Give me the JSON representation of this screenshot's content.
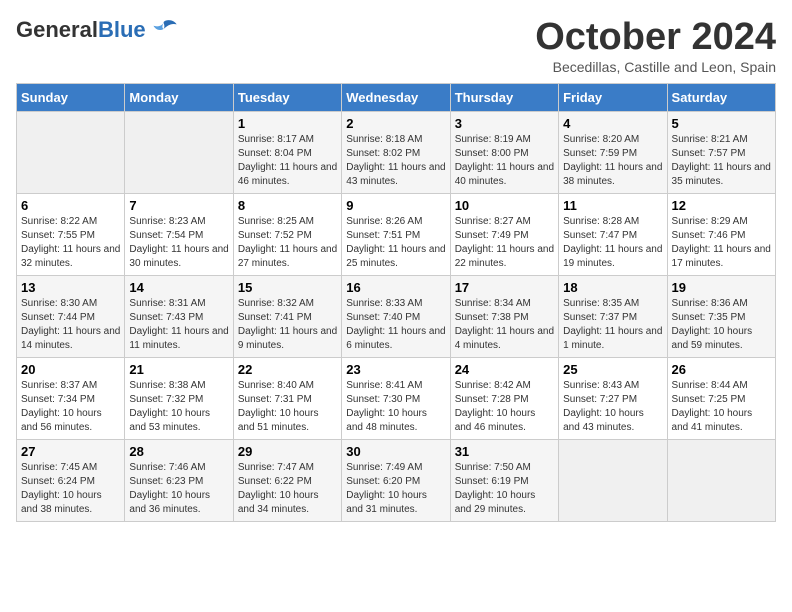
{
  "header": {
    "logo_general": "General",
    "logo_blue": "Blue",
    "month_title": "October 2024",
    "location": "Becedillas, Castille and Leon, Spain"
  },
  "days_of_week": [
    "Sunday",
    "Monday",
    "Tuesday",
    "Wednesday",
    "Thursday",
    "Friday",
    "Saturday"
  ],
  "weeks": [
    [
      {
        "day": "",
        "sunrise": "",
        "sunset": "",
        "daylight": ""
      },
      {
        "day": "",
        "sunrise": "",
        "sunset": "",
        "daylight": ""
      },
      {
        "day": "1",
        "sunrise": "Sunrise: 8:17 AM",
        "sunset": "Sunset: 8:04 PM",
        "daylight": "Daylight: 11 hours and 46 minutes."
      },
      {
        "day": "2",
        "sunrise": "Sunrise: 8:18 AM",
        "sunset": "Sunset: 8:02 PM",
        "daylight": "Daylight: 11 hours and 43 minutes."
      },
      {
        "day": "3",
        "sunrise": "Sunrise: 8:19 AM",
        "sunset": "Sunset: 8:00 PM",
        "daylight": "Daylight: 11 hours and 40 minutes."
      },
      {
        "day": "4",
        "sunrise": "Sunrise: 8:20 AM",
        "sunset": "Sunset: 7:59 PM",
        "daylight": "Daylight: 11 hours and 38 minutes."
      },
      {
        "day": "5",
        "sunrise": "Sunrise: 8:21 AM",
        "sunset": "Sunset: 7:57 PM",
        "daylight": "Daylight: 11 hours and 35 minutes."
      }
    ],
    [
      {
        "day": "6",
        "sunrise": "Sunrise: 8:22 AM",
        "sunset": "Sunset: 7:55 PM",
        "daylight": "Daylight: 11 hours and 32 minutes."
      },
      {
        "day": "7",
        "sunrise": "Sunrise: 8:23 AM",
        "sunset": "Sunset: 7:54 PM",
        "daylight": "Daylight: 11 hours and 30 minutes."
      },
      {
        "day": "8",
        "sunrise": "Sunrise: 8:25 AM",
        "sunset": "Sunset: 7:52 PM",
        "daylight": "Daylight: 11 hours and 27 minutes."
      },
      {
        "day": "9",
        "sunrise": "Sunrise: 8:26 AM",
        "sunset": "Sunset: 7:51 PM",
        "daylight": "Daylight: 11 hours and 25 minutes."
      },
      {
        "day": "10",
        "sunrise": "Sunrise: 8:27 AM",
        "sunset": "Sunset: 7:49 PM",
        "daylight": "Daylight: 11 hours and 22 minutes."
      },
      {
        "day": "11",
        "sunrise": "Sunrise: 8:28 AM",
        "sunset": "Sunset: 7:47 PM",
        "daylight": "Daylight: 11 hours and 19 minutes."
      },
      {
        "day": "12",
        "sunrise": "Sunrise: 8:29 AM",
        "sunset": "Sunset: 7:46 PM",
        "daylight": "Daylight: 11 hours and 17 minutes."
      }
    ],
    [
      {
        "day": "13",
        "sunrise": "Sunrise: 8:30 AM",
        "sunset": "Sunset: 7:44 PM",
        "daylight": "Daylight: 11 hours and 14 minutes."
      },
      {
        "day": "14",
        "sunrise": "Sunrise: 8:31 AM",
        "sunset": "Sunset: 7:43 PM",
        "daylight": "Daylight: 11 hours and 11 minutes."
      },
      {
        "day": "15",
        "sunrise": "Sunrise: 8:32 AM",
        "sunset": "Sunset: 7:41 PM",
        "daylight": "Daylight: 11 hours and 9 minutes."
      },
      {
        "day": "16",
        "sunrise": "Sunrise: 8:33 AM",
        "sunset": "Sunset: 7:40 PM",
        "daylight": "Daylight: 11 hours and 6 minutes."
      },
      {
        "day": "17",
        "sunrise": "Sunrise: 8:34 AM",
        "sunset": "Sunset: 7:38 PM",
        "daylight": "Daylight: 11 hours and 4 minutes."
      },
      {
        "day": "18",
        "sunrise": "Sunrise: 8:35 AM",
        "sunset": "Sunset: 7:37 PM",
        "daylight": "Daylight: 11 hours and 1 minute."
      },
      {
        "day": "19",
        "sunrise": "Sunrise: 8:36 AM",
        "sunset": "Sunset: 7:35 PM",
        "daylight": "Daylight: 10 hours and 59 minutes."
      }
    ],
    [
      {
        "day": "20",
        "sunrise": "Sunrise: 8:37 AM",
        "sunset": "Sunset: 7:34 PM",
        "daylight": "Daylight: 10 hours and 56 minutes."
      },
      {
        "day": "21",
        "sunrise": "Sunrise: 8:38 AM",
        "sunset": "Sunset: 7:32 PM",
        "daylight": "Daylight: 10 hours and 53 minutes."
      },
      {
        "day": "22",
        "sunrise": "Sunrise: 8:40 AM",
        "sunset": "Sunset: 7:31 PM",
        "daylight": "Daylight: 10 hours and 51 minutes."
      },
      {
        "day": "23",
        "sunrise": "Sunrise: 8:41 AM",
        "sunset": "Sunset: 7:30 PM",
        "daylight": "Daylight: 10 hours and 48 minutes."
      },
      {
        "day": "24",
        "sunrise": "Sunrise: 8:42 AM",
        "sunset": "Sunset: 7:28 PM",
        "daylight": "Daylight: 10 hours and 46 minutes."
      },
      {
        "day": "25",
        "sunrise": "Sunrise: 8:43 AM",
        "sunset": "Sunset: 7:27 PM",
        "daylight": "Daylight: 10 hours and 43 minutes."
      },
      {
        "day": "26",
        "sunrise": "Sunrise: 8:44 AM",
        "sunset": "Sunset: 7:25 PM",
        "daylight": "Daylight: 10 hours and 41 minutes."
      }
    ],
    [
      {
        "day": "27",
        "sunrise": "Sunrise: 7:45 AM",
        "sunset": "Sunset: 6:24 PM",
        "daylight": "Daylight: 10 hours and 38 minutes."
      },
      {
        "day": "28",
        "sunrise": "Sunrise: 7:46 AM",
        "sunset": "Sunset: 6:23 PM",
        "daylight": "Daylight: 10 hours and 36 minutes."
      },
      {
        "day": "29",
        "sunrise": "Sunrise: 7:47 AM",
        "sunset": "Sunset: 6:22 PM",
        "daylight": "Daylight: 10 hours and 34 minutes."
      },
      {
        "day": "30",
        "sunrise": "Sunrise: 7:49 AM",
        "sunset": "Sunset: 6:20 PM",
        "daylight": "Daylight: 10 hours and 31 minutes."
      },
      {
        "day": "31",
        "sunrise": "Sunrise: 7:50 AM",
        "sunset": "Sunset: 6:19 PM",
        "daylight": "Daylight: 10 hours and 29 minutes."
      },
      {
        "day": "",
        "sunrise": "",
        "sunset": "",
        "daylight": ""
      },
      {
        "day": "",
        "sunrise": "",
        "sunset": "",
        "daylight": ""
      }
    ]
  ]
}
